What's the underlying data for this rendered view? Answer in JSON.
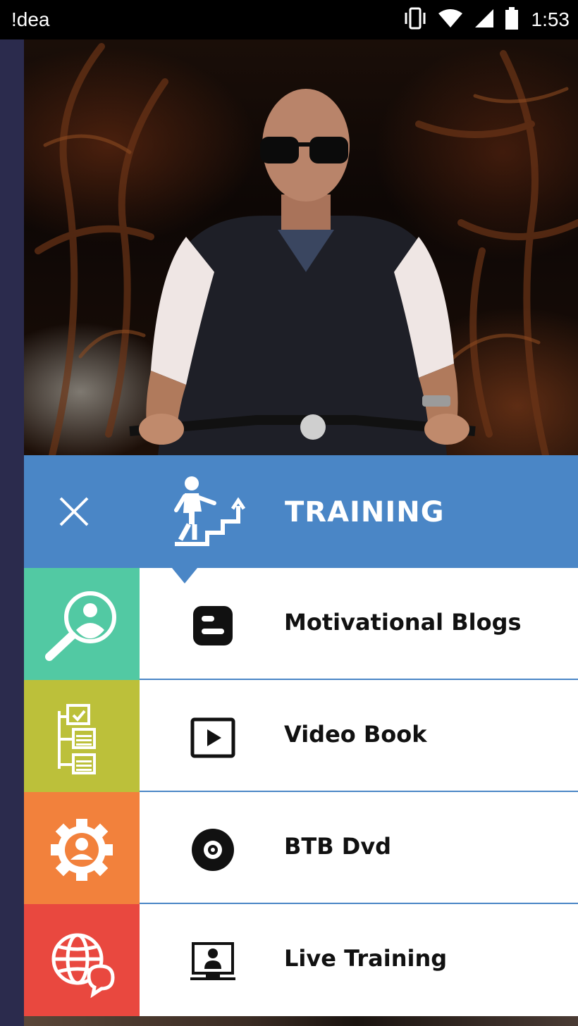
{
  "status_bar": {
    "carrier": "!dea",
    "time": "1:53",
    "icons": [
      "vibrate-icon",
      "wifi-icon",
      "signal-icon",
      "battery-icon"
    ]
  },
  "header": {
    "title": "TRAINING",
    "icon": "staircase-climb-icon",
    "close_icon": "close-icon",
    "color": "#4a86c6"
  },
  "menu": {
    "items": [
      {
        "label": "Motivational Blogs",
        "icon": "blogger-icon",
        "side_icon": "search-user-icon",
        "side_color": "#52c9a3"
      },
      {
        "label": "Video Book",
        "icon": "play-video-icon",
        "side_icon": "calendar-tree-icon",
        "side_color": "#bcc03a"
      },
      {
        "label": "BTB Dvd",
        "icon": "dvd-icon",
        "side_icon": "gear-user-icon",
        "side_color": "#f2813c"
      },
      {
        "label": "Live Training",
        "icon": "live-presenter-icon",
        "side_icon": "globe-chat-icon",
        "side_color": "#e9483f"
      }
    ]
  }
}
